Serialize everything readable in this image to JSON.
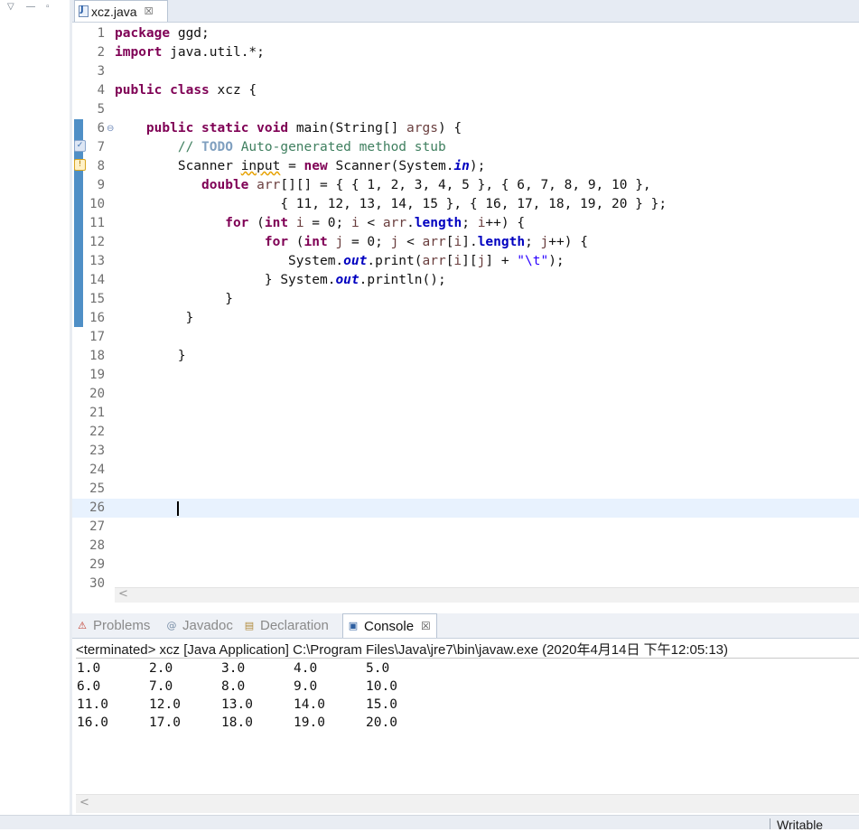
{
  "window": {
    "left_view_controls": [
      "▽",
      "—",
      "▫"
    ]
  },
  "editor": {
    "tab": {
      "label": "xcz.java",
      "close": "☒"
    },
    "lines": [
      {
        "n": "1",
        "fold": "",
        "tokens": [
          {
            "t": "kw",
            "v": "package"
          },
          {
            "t": "",
            "v": " ggd;"
          }
        ]
      },
      {
        "n": "2",
        "fold": "",
        "tokens": [
          {
            "t": "kw",
            "v": "import"
          },
          {
            "t": "",
            "v": " java.util.*;"
          }
        ]
      },
      {
        "n": "3",
        "fold": "",
        "tokens": []
      },
      {
        "n": "4",
        "fold": "",
        "tokens": [
          {
            "t": "kw",
            "v": "public"
          },
          {
            "t": "",
            "v": " "
          },
          {
            "t": "kw",
            "v": "class"
          },
          {
            "t": "",
            "v": " xcz {"
          }
        ]
      },
      {
        "n": "5",
        "fold": "",
        "tokens": []
      },
      {
        "n": "6",
        "fold": "⊖",
        "tokens": [
          {
            "t": "",
            "v": "    "
          },
          {
            "t": "kw",
            "v": "public"
          },
          {
            "t": "",
            "v": " "
          },
          {
            "t": "kw",
            "v": "static"
          },
          {
            "t": "",
            "v": " "
          },
          {
            "t": "kw",
            "v": "void"
          },
          {
            "t": "",
            "v": " main(String[] "
          },
          {
            "t": "var",
            "v": "args"
          },
          {
            "t": "",
            "v": ") {"
          }
        ]
      },
      {
        "n": "7",
        "fold": "",
        "tokens": [
          {
            "t": "",
            "v": "        "
          },
          {
            "t": "cm",
            "v": "// "
          },
          {
            "t": "todo",
            "v": "TODO"
          },
          {
            "t": "cm",
            "v": " Auto-generated method stub"
          }
        ]
      },
      {
        "n": "8",
        "fold": "",
        "tokens": [
          {
            "t": "",
            "v": "        Scanner "
          },
          {
            "t": "warnvar",
            "v": "input"
          },
          {
            "t": "",
            "v": " = "
          },
          {
            "t": "kw",
            "v": "new"
          },
          {
            "t": "",
            "v": " Scanner(System."
          },
          {
            "t": "sfld",
            "v": "in"
          },
          {
            "t": "",
            "v": ");"
          }
        ]
      },
      {
        "n": "9",
        "fold": "",
        "tokens": [
          {
            "t": "",
            "v": "           "
          },
          {
            "t": "kw",
            "v": "double"
          },
          {
            "t": "",
            "v": " "
          },
          {
            "t": "var",
            "v": "arr"
          },
          {
            "t": "",
            "v": "[][] = { { 1, 2, 3, 4, 5 }, { 6, 7, 8, 9, 10 },"
          }
        ]
      },
      {
        "n": "10",
        "fold": "",
        "tokens": [
          {
            "t": "",
            "v": "                     { 11, 12, 13, 14, 15 }, { 16, 17, 18, 19, 20 } };"
          }
        ]
      },
      {
        "n": "11",
        "fold": "",
        "tokens": [
          {
            "t": "",
            "v": "              "
          },
          {
            "t": "kw",
            "v": "for"
          },
          {
            "t": "",
            "v": " ("
          },
          {
            "t": "kw",
            "v": "int"
          },
          {
            "t": "",
            "v": " "
          },
          {
            "t": "var",
            "v": "i"
          },
          {
            "t": "",
            "v": " = 0; "
          },
          {
            "t": "var",
            "v": "i"
          },
          {
            "t": "",
            "v": " < "
          },
          {
            "t": "var",
            "v": "arr"
          },
          {
            "t": "",
            "v": "."
          },
          {
            "t": "fld",
            "v": "length"
          },
          {
            "t": "",
            "v": "; "
          },
          {
            "t": "var",
            "v": "i"
          },
          {
            "t": "",
            "v": "++) {"
          }
        ]
      },
      {
        "n": "12",
        "fold": "",
        "tokens": [
          {
            "t": "",
            "v": "                   "
          },
          {
            "t": "kw",
            "v": "for"
          },
          {
            "t": "",
            "v": " ("
          },
          {
            "t": "kw",
            "v": "int"
          },
          {
            "t": "",
            "v": " "
          },
          {
            "t": "var",
            "v": "j"
          },
          {
            "t": "",
            "v": " = 0; "
          },
          {
            "t": "var",
            "v": "j"
          },
          {
            "t": "",
            "v": " < "
          },
          {
            "t": "var",
            "v": "arr"
          },
          {
            "t": "",
            "v": "["
          },
          {
            "t": "var",
            "v": "i"
          },
          {
            "t": "",
            "v": "]."
          },
          {
            "t": "fld",
            "v": "length"
          },
          {
            "t": "",
            "v": "; "
          },
          {
            "t": "var",
            "v": "j"
          },
          {
            "t": "",
            "v": "++) {"
          }
        ]
      },
      {
        "n": "13",
        "fold": "",
        "tokens": [
          {
            "t": "",
            "v": "                      System."
          },
          {
            "t": "sfld",
            "v": "out"
          },
          {
            "t": "",
            "v": ".print("
          },
          {
            "t": "var",
            "v": "arr"
          },
          {
            "t": "",
            "v": "["
          },
          {
            "t": "var",
            "v": "i"
          },
          {
            "t": "",
            "v": "]["
          },
          {
            "t": "var",
            "v": "j"
          },
          {
            "t": "",
            "v": "] + "
          },
          {
            "t": "str",
            "v": "\"\\t\""
          },
          {
            "t": "",
            "v": ");"
          }
        ]
      },
      {
        "n": "14",
        "fold": "",
        "tokens": [
          {
            "t": "",
            "v": "                   } System."
          },
          {
            "t": "sfld",
            "v": "out"
          },
          {
            "t": "",
            "v": ".println();"
          }
        ]
      },
      {
        "n": "15",
        "fold": "",
        "tokens": [
          {
            "t": "",
            "v": "              }"
          }
        ]
      },
      {
        "n": "16",
        "fold": "",
        "tokens": [
          {
            "t": "",
            "v": "         }"
          }
        ]
      },
      {
        "n": "17",
        "fold": "",
        "tokens": []
      },
      {
        "n": "18",
        "fold": "",
        "tokens": [
          {
            "t": "",
            "v": "        }"
          }
        ]
      },
      {
        "n": "19",
        "fold": "",
        "tokens": []
      },
      {
        "n": "20",
        "fold": "",
        "tokens": []
      },
      {
        "n": "21",
        "fold": "",
        "tokens": []
      },
      {
        "n": "22",
        "fold": "",
        "tokens": []
      },
      {
        "n": "23",
        "fold": "",
        "tokens": []
      },
      {
        "n": "24",
        "fold": "",
        "tokens": []
      },
      {
        "n": "25",
        "fold": "",
        "tokens": []
      },
      {
        "n": "26",
        "fold": "",
        "tokens": [],
        "current": true
      },
      {
        "n": "27",
        "fold": "",
        "tokens": []
      },
      {
        "n": "28",
        "fold": "",
        "tokens": []
      },
      {
        "n": "29",
        "fold": "",
        "tokens": []
      },
      {
        "n": "30",
        "fold": "",
        "tokens": []
      }
    ],
    "scroll_arrow": "<"
  },
  "bottom_tabs": [
    {
      "label": "Problems",
      "icon": "problems-icon",
      "glyph": "⚠",
      "active": false
    },
    {
      "label": "Javadoc",
      "icon": "javadoc-icon",
      "glyph": "@",
      "active": false
    },
    {
      "label": "Declaration",
      "icon": "declaration-icon",
      "glyph": "▤",
      "active": false
    },
    {
      "label": "Console",
      "icon": "console-icon",
      "glyph": "▣",
      "active": true,
      "close": "☒"
    }
  ],
  "console": {
    "header": "<terminated> xcz [Java Application] C:\\Program Files\\Java\\jre7\\bin\\javaw.exe (2020年4月14日 下午12:05:13)",
    "rows": [
      [
        "1.0",
        "2.0",
        "3.0",
        "4.0",
        "5.0"
      ],
      [
        "6.0",
        "7.0",
        "8.0",
        "9.0",
        "10.0"
      ],
      [
        "11.0",
        "12.0",
        "13.0",
        "14.0",
        "15.0"
      ],
      [
        "16.0",
        "17.0",
        "18.0",
        "19.0",
        "20.0"
      ]
    ],
    "scroll_arrow": "<"
  },
  "status": {
    "text": "Writable"
  },
  "colors": {
    "keyword": "#7f0055",
    "comment": "#3f7f5f",
    "string": "#2a00ff",
    "field": "#0000c0",
    "annotation_bar": "#4f8fc6",
    "current_line": "#e8f2fe"
  }
}
